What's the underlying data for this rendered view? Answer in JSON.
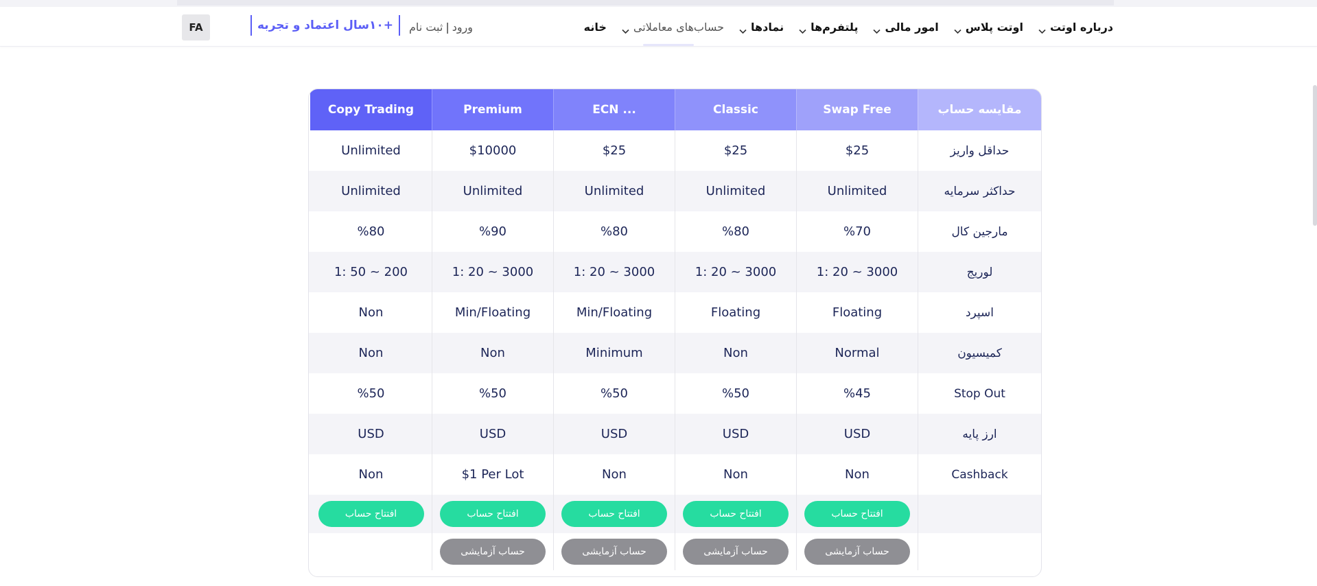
{
  "header": {
    "language": "FA",
    "badge": "+۱۰سال اعتماد و تجربه",
    "login": "ورود",
    "separator": "|",
    "register": "ثبت نام",
    "menu": [
      {
        "label": "خانه",
        "has_dropdown": false,
        "muted": false
      },
      {
        "label": "حساب‌های معاملاتی",
        "has_dropdown": true,
        "muted": true
      },
      {
        "label": "نمادها",
        "has_dropdown": true,
        "muted": false
      },
      {
        "label": "پلتفرم‌ها",
        "has_dropdown": true,
        "muted": false
      },
      {
        "label": "امور مالی",
        "has_dropdown": true,
        "muted": false
      },
      {
        "label": "اوتت پلاس",
        "has_dropdown": true,
        "muted": false
      },
      {
        "label": "درباره اوتت",
        "has_dropdown": true,
        "muted": false
      }
    ]
  },
  "comparison": {
    "corner_label": "مقایسه حساب",
    "accounts": [
      {
        "name": "Swap Free",
        "color": "#9fa1fa"
      },
      {
        "name": "Classic",
        "color": "#8f92fb"
      },
      {
        "name": "ECN ...",
        "color": "#8083fb"
      },
      {
        "name": "Premium",
        "color": "#7174fb"
      },
      {
        "name": "Copy Trading",
        "color": "#5f62f7"
      }
    ],
    "corner_color": "#b4b6fc",
    "rows": [
      {
        "label": "حداقل واریز",
        "values": [
          "$25",
          "$25",
          "$25",
          "$10000",
          "Unlimited"
        ]
      },
      {
        "label": "حداکثر سرمایه",
        "values": [
          "Unlimited",
          "Unlimited",
          "Unlimited",
          "Unlimited",
          "Unlimited"
        ]
      },
      {
        "label": "مارجین کال",
        "values": [
          "%70",
          "%80",
          "%80",
          "%90",
          "%80"
        ]
      },
      {
        "label": "لوریج",
        "values": [
          "1: 20 ~ 3000",
          "1: 20 ~ 3000",
          "1: 20 ~ 3000",
          "1: 20 ~ 3000",
          "1: 50 ~ 200"
        ]
      },
      {
        "label": "اسپرد",
        "values": [
          "Floating",
          "Floating",
          "Min/Floating",
          "Min/Floating",
          "Non"
        ]
      },
      {
        "label": "کمیسیون",
        "values": [
          "Normal",
          "Non",
          "Minimum",
          "Non",
          "Non"
        ]
      },
      {
        "label": "Stop Out",
        "values": [
          "%45",
          "%50",
          "%50",
          "%50",
          "%50"
        ]
      },
      {
        "label": "ارز پایه",
        "values": [
          "USD",
          "USD",
          "USD",
          "USD",
          "USD"
        ]
      },
      {
        "label": "Cashback",
        "values": [
          "Non",
          "Non",
          "Non",
          "$1 Per Lot",
          "Non"
        ]
      }
    ],
    "open_account_label": "افتتاح حساب",
    "demo_account_label": "حساب آزمایشی",
    "demo_available": [
      true,
      true,
      true,
      true,
      false
    ]
  },
  "colors": {
    "accent": "#5b5ef6",
    "green_button": "#26dca0",
    "gray_button": "#8f8f94"
  }
}
